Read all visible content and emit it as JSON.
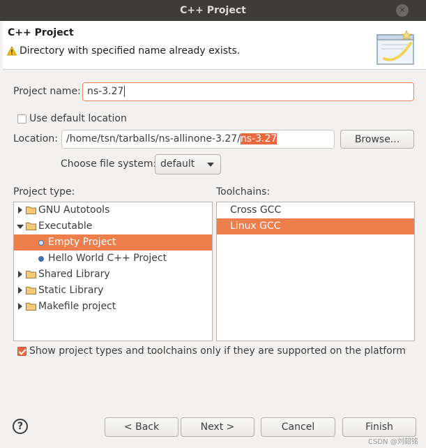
{
  "window": {
    "title": "C++ Project"
  },
  "header": {
    "title": "C++ Project",
    "message": "Directory with specified name already exists."
  },
  "project_name": {
    "label": "Project name:",
    "value": "ns-3.27"
  },
  "use_default_location": {
    "label": "Use default location",
    "checked": false
  },
  "location": {
    "label": "Location:",
    "value_prefix": "/home/tsn/tarballs/ns-allinone-3.27/",
    "value_selected": "ns-3.27",
    "browse_label": "Browse..."
  },
  "file_system": {
    "label": "Choose file system:",
    "selected": "default"
  },
  "project_type": {
    "label": "Project type:",
    "items": [
      {
        "label": "GNU Autotools",
        "kind": "folder",
        "expanded": false,
        "level": 0
      },
      {
        "label": "Executable",
        "kind": "folder",
        "expanded": true,
        "level": 0
      },
      {
        "label": "Empty Project",
        "kind": "item",
        "level": 1,
        "selected": true
      },
      {
        "label": "Hello World C++ Project",
        "kind": "item",
        "level": 1
      },
      {
        "label": "Shared Library",
        "kind": "folder",
        "expanded": false,
        "level": 0
      },
      {
        "label": "Static Library",
        "kind": "folder",
        "expanded": false,
        "level": 0
      },
      {
        "label": "Makefile project",
        "kind": "folder",
        "expanded": false,
        "level": 0
      }
    ]
  },
  "toolchains": {
    "label": "Toolchains:",
    "items": [
      {
        "label": "Cross GCC"
      },
      {
        "label": "Linux GCC",
        "selected": true
      }
    ]
  },
  "supported_only": {
    "label": "Show project types and toolchains only if they are supported on the platform",
    "checked": true
  },
  "buttons": {
    "help": "?",
    "back": "< Back",
    "next": "Next >",
    "cancel": "Cancel",
    "finish": "Finish"
  },
  "watermark": "CSDN @刘韶铭",
  "colors": {
    "accent": "#e9683e",
    "selection": "#ee7e4b",
    "titlebar": "#3d3c38"
  }
}
